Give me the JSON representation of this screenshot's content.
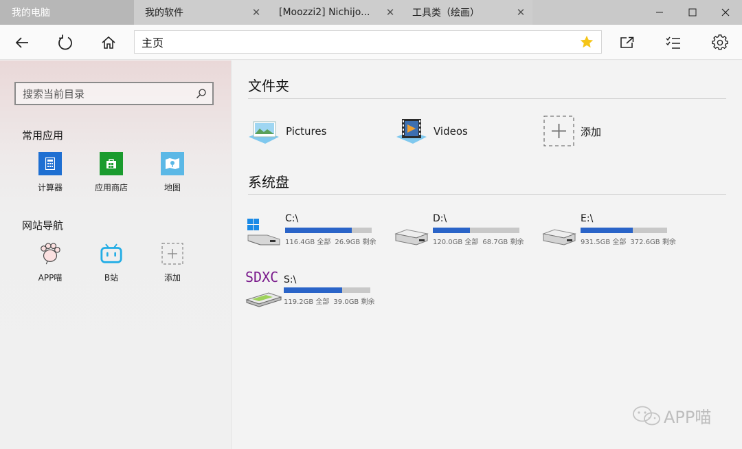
{
  "tabs": [
    {
      "label": "我的电脑",
      "active": true
    },
    {
      "label": "我的软件"
    },
    {
      "label": "[Moozzi2] Nichijo..."
    },
    {
      "label": "工具类（绘画）"
    }
  ],
  "window_controls": {
    "minimize": "minimize",
    "maximize": "maximize",
    "close": "close"
  },
  "address": {
    "value": "主页"
  },
  "sidebar": {
    "search_placeholder": "搜索当前目录",
    "common_apps_title": "常用应用",
    "common_apps": [
      {
        "label": "计算器",
        "icon": "calculator-icon",
        "color": "#1e6fd2"
      },
      {
        "label": "应用商店",
        "icon": "store-icon",
        "color": "#1a9b2e"
      },
      {
        "label": "地图",
        "icon": "maps-icon",
        "color": "#5bb8e6"
      }
    ],
    "sites_title": "网站导航",
    "sites": [
      {
        "label": "APP喵",
        "icon": "app-miao-paw-icon"
      },
      {
        "label": "B站",
        "icon": "bilibili-icon",
        "color": "#23ade5"
      },
      {
        "label": "添加",
        "icon": "add-icon"
      }
    ]
  },
  "main": {
    "folders_title": "文件夹",
    "folders": [
      {
        "label": "Pictures",
        "icon": "pictures-folder-icon"
      },
      {
        "label": "Videos",
        "icon": "videos-folder-icon"
      },
      {
        "label": "添加",
        "icon": "add-icon"
      }
    ],
    "drives_title": "系统盘",
    "drives": [
      {
        "name": "C:\\",
        "total": "116.4GB 全部",
        "free": "26.9GB 剩余",
        "used_fraction": 0.769,
        "icon": "windows-drive-icon"
      },
      {
        "name": "D:\\",
        "total": "120.0GB 全部",
        "free": "68.7GB 剩余",
        "used_fraction": 0.428,
        "icon": "hard-drive-icon"
      },
      {
        "name": "E:\\",
        "total": "931.5GB 全部",
        "free": "372.6GB 剩余",
        "used_fraction": 0.6,
        "icon": "hard-drive-icon"
      },
      {
        "name": "S:\\",
        "total": "119.2GB 全部",
        "free": "39.0GB 剩余",
        "used_fraction": 0.673,
        "icon": "sdxc-card-drive-icon",
        "badge": "SDXC"
      }
    ]
  },
  "watermark": {
    "text": "APP喵"
  },
  "colors": {
    "accent": "#2a64c8",
    "star": "#f5c518",
    "titlebar": "#c9c9c9"
  }
}
